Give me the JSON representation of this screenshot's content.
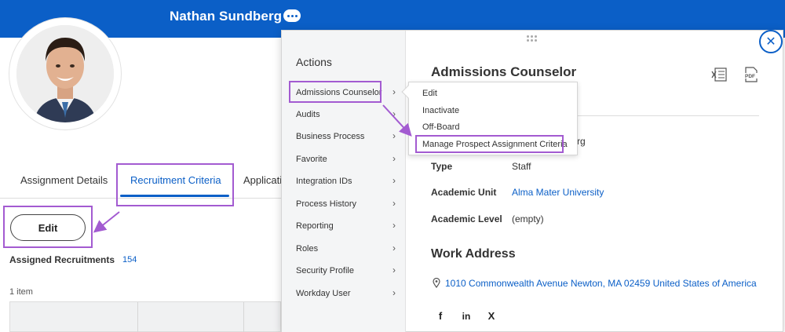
{
  "header": {
    "profile_name": "Nathan Sundberg"
  },
  "tabs": [
    "Assignment Details",
    "Recruitment Criteria",
    "Applicatio"
  ],
  "edit_label": "Edit",
  "assigned": {
    "label": "Assigned Recruitments",
    "count": "154",
    "items": "1 item"
  },
  "actions": {
    "title": "Actions",
    "items": [
      "Admissions Counselor",
      "Audits",
      "Business Process",
      "Favorite",
      "Integration IDs",
      "Process History",
      "Reporting",
      "Roles",
      "Security Profile",
      "Workday User"
    ]
  },
  "submenu": [
    "Edit",
    "Inactivate",
    "Off-Board",
    "Manage Prospect Assignment Criteria"
  ],
  "detail": {
    "title": "Admissions Counselor",
    "partial": "rg",
    "fields": [
      {
        "label": "Type",
        "value": "Staff"
      },
      {
        "label": "Academic Unit",
        "value": "Alma Mater University"
      },
      {
        "label": "Academic Level",
        "value": "(empty)"
      }
    ],
    "work_address_title": "Work Address",
    "address": "1010 Commonwealth Avenue Newton, MA 02459 United States of America"
  },
  "icons": {
    "excel": "excel-export-icon",
    "pdf": "pdf-export-icon",
    "close": "close-icon",
    "more": "more-icon",
    "pin": "location-pin-icon"
  },
  "social": [
    "f",
    "in",
    "X"
  ],
  "colors": {
    "accent": "#0b5fc7",
    "highlight": "#a35bd1"
  }
}
